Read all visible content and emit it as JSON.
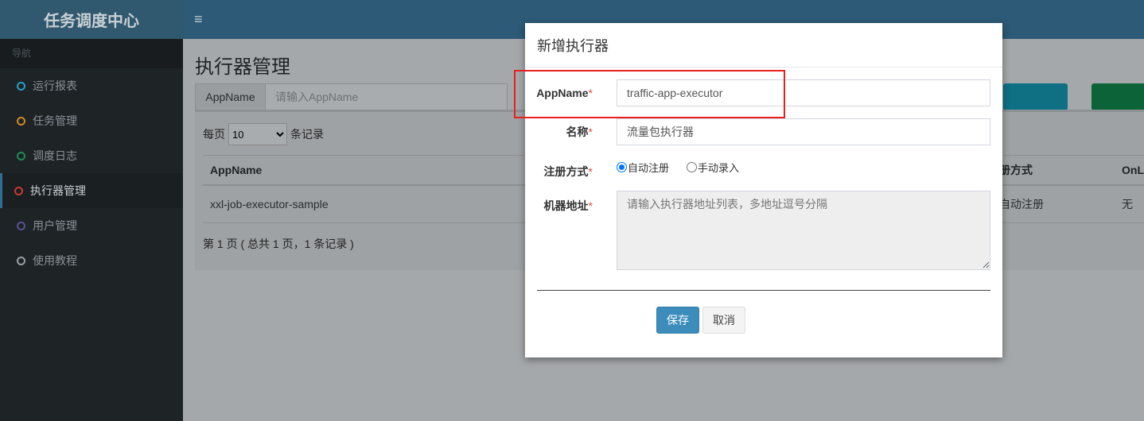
{
  "sidebar": {
    "logo": "任务调度中心",
    "nav_header": "导航",
    "items": [
      {
        "label": "运行报表",
        "color": "#26a0c9"
      },
      {
        "label": "任务管理",
        "color": "#d08a1c"
      },
      {
        "label": "调度日志",
        "color": "#1f8d55"
      },
      {
        "label": "执行器管理",
        "color": "#cc3a2f"
      },
      {
        "label": "用户管理",
        "color": "#5a4f92"
      },
      {
        "label": "使用教程",
        "color": "#9aa0a4"
      }
    ],
    "active_index": 3
  },
  "page": {
    "title": "执行器管理",
    "search": {
      "addon": "AppName",
      "placeholder": "请输入AppName"
    },
    "pagesize": {
      "prefix": "每页",
      "value": "10",
      "suffix": "条记录"
    },
    "table": {
      "headers": [
        "AppName",
        "册方式",
        "OnL"
      ],
      "rows": [
        [
          "xxl-job-executor-sample",
          "自动注册",
          "无"
        ]
      ]
    },
    "page_info": "第 1 页 ( 总共 1 页，1 条记录 )"
  },
  "modal": {
    "title": "新增执行器",
    "appname_label": "AppName",
    "appname_value": "traffic-app-executor",
    "name_label": "名称",
    "name_value": "流量包执行器",
    "reg_label": "注册方式",
    "reg_auto": "自动注册",
    "reg_manual": "手动录入",
    "address_label": "机器地址",
    "address_placeholder": "请输入执行器地址列表，多地址逗号分隔",
    "required_mark": "*",
    "save": "保存",
    "cancel": "取消"
  }
}
